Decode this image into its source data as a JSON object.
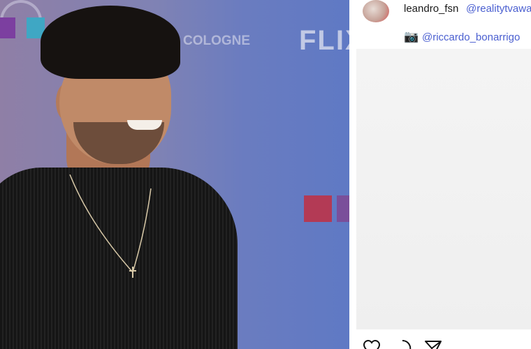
{
  "photo": {
    "backdrop_words": {
      "flix": "FLIX",
      "cologne": "COLOGNE"
    }
  },
  "post": {
    "username": "leandro_fsn",
    "mention_1": "@realitytvawa",
    "mention_2": "@riccardo_bonarrigo",
    "camera_icon": "📷",
    "actions": [
      "heart-icon",
      "comment-icon",
      "share-icon"
    ]
  }
}
